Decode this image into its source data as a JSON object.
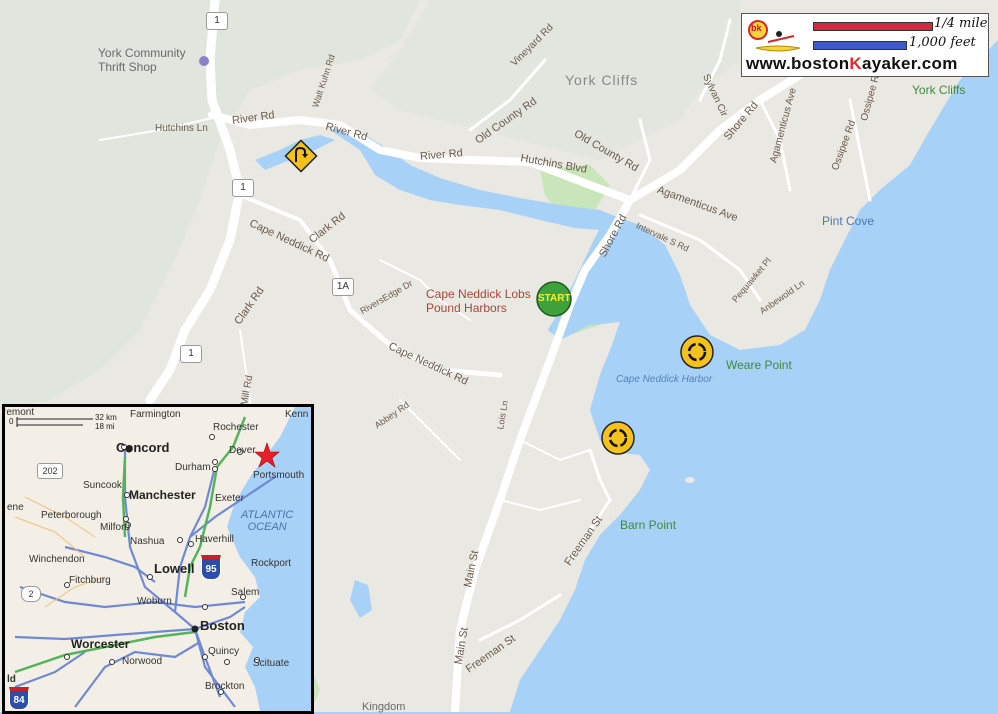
{
  "map": {
    "labels": {
      "york_thrift": "York Community\nThrift Shop",
      "york_cliffs_area": "York Cliffs",
      "york_cliffs_green": "York Cliffs",
      "pint_cove": "Pint Cove",
      "cape_neddick_harbor": "Cape Neddick Harbor",
      "weare_point": "Weare Point",
      "barn_point": "Barn Point",
      "business": "Cape Neddick Lobs\nPound Harbors",
      "kingdom": "Kingdom"
    },
    "roads": {
      "river_rd_1": "River Rd",
      "river_rd_2": "River Rd",
      "river_rd_3": "River Rd",
      "hutchins_ln": "Hutchins Ln",
      "hutchins_blvd": "Hutchins Blvd",
      "walt_kuhn": "Walt Kuhn Rd",
      "vineyard": "Vineyard Rd",
      "old_county_1": "Old County Rd",
      "old_county_2": "Old County Rd",
      "sylvan": "Sylvan Cir",
      "shore_rd_top": "Shore Rd",
      "shore_rd_mid": "Shore Rd",
      "agamenticus_ave_1": "Agamenticus Ave",
      "agamenticus_ave_2": "Agamenticus Ave",
      "ossipee_1": "Ossipee Rd",
      "ossipee_2": "Ossipee Rd",
      "intervale": "Intervale S Rd",
      "pequawket": "Pequawket Pl",
      "anbewold": "Anbewold Ln",
      "clark_rd_1": "Clark Rd",
      "clark_rd_2": "Clark Rd",
      "cape_neddick_rd_1": "Cape Neddick Rd",
      "cape_neddick_rd_2": "Cape Neddick Rd",
      "riversedge": "RiversEdge Dr",
      "mill_rd": "Mill Rd",
      "abbey": "Abbey Rd",
      "lois": "Lois Ln",
      "main_st_1": "Main St",
      "main_st_2": "Main St",
      "freeman_1": "Freeman St",
      "freeman_2": "Freeman St"
    },
    "shields": {
      "us1_a": "1",
      "us1_b": "1",
      "us1_c": "1",
      "rt1a": "1A"
    },
    "markers": {
      "start": "START"
    }
  },
  "brand": {
    "logo_letters": "bk",
    "scale_mile": "1/4 mile",
    "scale_feet": "1,000 feet",
    "url_pre": "www.boston",
    "url_k": "K",
    "url_post": "ayaker.com"
  },
  "inset": {
    "scale_km": "32 km",
    "scale_mi": "18 mi",
    "scale_zero": "0",
    "cities": {
      "concord": "Concord",
      "manchester": "Manchester",
      "lowell": "Lowell",
      "boston": "Boston",
      "worcester": "Worcester"
    },
    "towns": {
      "farmington": "Farmington",
      "rochester": "Rochester",
      "dover": "Dover",
      "durham": "Durham",
      "portsmouth": "Portsmouth",
      "kenn": "Kenn",
      "suncook": "Suncook",
      "exeter": "Exeter",
      "peterborough": "Peterborough",
      "milford": "Milford",
      "nashua": "Nashua",
      "haverhill": "Haverhill",
      "winchendon": "Winchendon",
      "fitchburg": "Fitchburg",
      "rockport": "Rockport",
      "woburn": "Woburn",
      "salem": "Salem",
      "quincy": "Quincy",
      "norwood": "Norwood",
      "scituate": "Scituate",
      "brockton": "Brockton",
      "ene": "ene",
      "remont": "remont",
      "ld": "ld"
    },
    "ocean": "ATLANTIC\nOCEAN",
    "shields": {
      "rt202": "202",
      "rt2": "2",
      "i95": "95",
      "i84": "84"
    }
  }
}
